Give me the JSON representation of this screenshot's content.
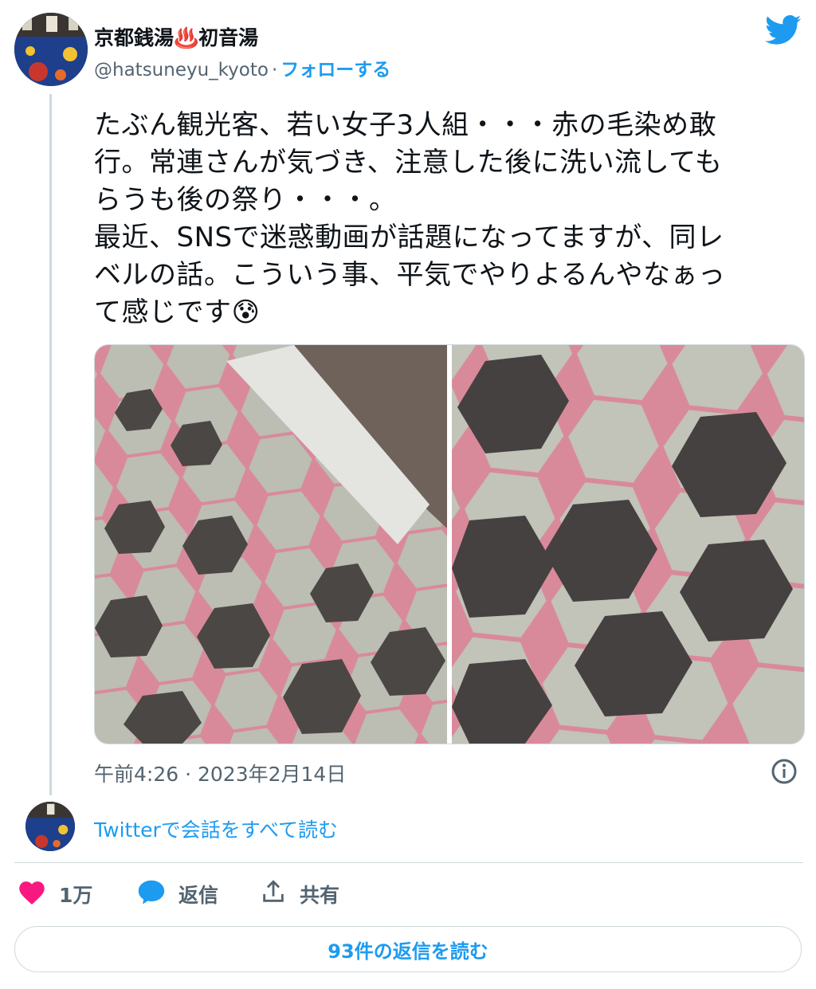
{
  "author": {
    "display_name": "京都銭湯♨️初音湯",
    "handle": "@hatsuneyu_kyoto",
    "separator": "·",
    "follow_label": "フォローする"
  },
  "tweet": {
    "text": "たぶん観光客、若い女子3人組・・・赤の毛染め敢\n行。常連さんが気づき、注意した後に洗い流しても\nらうも後の祭り・・・。\n最近、SNSで迷惑動画が話題になってますが、同レ\nベルの話。こういう事、平気でやりよるんやなぁっ\nて感じです😰",
    "timestamp": "午前4:26 · 2023年2月14日",
    "images": [
      {
        "name": "tile-floor-photo-1",
        "subject": "hexagonal tile floor with pink-stained grout near wall"
      },
      {
        "name": "tile-floor-photo-2",
        "subject": "close-up of hexagonal tiles with pink-stained grout"
      }
    ]
  },
  "conversation": {
    "read_all_label": "Twitterで会話をすべて読む"
  },
  "actions": {
    "like_count": "1万",
    "reply_label": "返信",
    "share_label": "共有"
  },
  "replies_button_label": "93件の返信を読む",
  "colors": {
    "accent": "#1d9bf0",
    "like": "#f91880",
    "text": "#0f1419",
    "secondary": "#536471",
    "border": "#cfd9de"
  },
  "icons": [
    "twitter-bird-icon",
    "info-icon",
    "heart-icon",
    "reply-bubble-icon",
    "share-icon"
  ]
}
